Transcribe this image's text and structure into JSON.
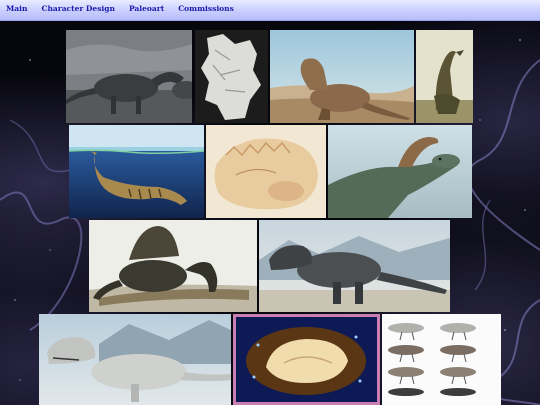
{
  "nav": {
    "items": [
      {
        "label": "Main"
      },
      {
        "label": "Character Design"
      },
      {
        "label": "Paleoart"
      },
      {
        "label": "Commissions"
      }
    ]
  },
  "colors": {
    "nav_bar": "#c9ceff",
    "nav_text": "#1a1aa8",
    "page_background": "#06060d"
  },
  "gallery": {
    "thumbnails": [
      {
        "subject": "hadrosaur-herd"
      },
      {
        "subject": "pale-sketch"
      },
      {
        "subject": "resting-theropod"
      },
      {
        "subject": "long-necked-theropod"
      },
      {
        "subject": "swimming-thylacine"
      },
      {
        "subject": "sleeping-sauropod-sketch"
      },
      {
        "subject": "parasaurolophus-head"
      },
      {
        "subject": "spinosaurus"
      },
      {
        "subject": "tyrannosaurus-walking"
      },
      {
        "subject": "tyrannosaurus-running"
      },
      {
        "subject": "curled-sleeping-creature"
      },
      {
        "subject": "theropod-model-sheet"
      }
    ]
  }
}
